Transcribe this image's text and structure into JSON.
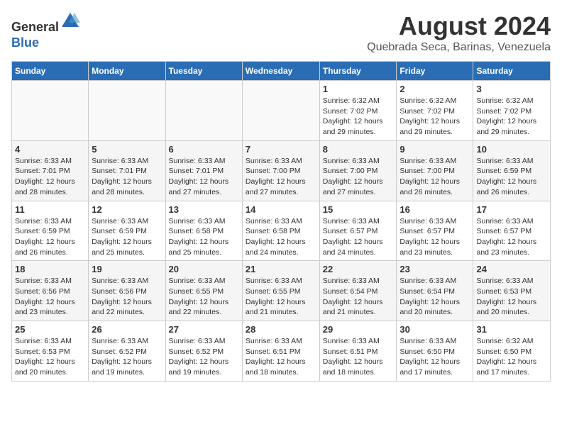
{
  "header": {
    "logo_line1": "General",
    "logo_line2": "Blue",
    "month_title": "August 2024",
    "subtitle": "Quebrada Seca, Barinas, Venezuela"
  },
  "days_of_week": [
    "Sunday",
    "Monday",
    "Tuesday",
    "Wednesday",
    "Thursday",
    "Friday",
    "Saturday"
  ],
  "weeks": [
    [
      {
        "day": "",
        "info": ""
      },
      {
        "day": "",
        "info": ""
      },
      {
        "day": "",
        "info": ""
      },
      {
        "day": "",
        "info": ""
      },
      {
        "day": "1",
        "info": "Sunrise: 6:32 AM\nSunset: 7:02 PM\nDaylight: 12 hours\nand 29 minutes."
      },
      {
        "day": "2",
        "info": "Sunrise: 6:32 AM\nSunset: 7:02 PM\nDaylight: 12 hours\nand 29 minutes."
      },
      {
        "day": "3",
        "info": "Sunrise: 6:32 AM\nSunset: 7:02 PM\nDaylight: 12 hours\nand 29 minutes."
      }
    ],
    [
      {
        "day": "4",
        "info": "Sunrise: 6:33 AM\nSunset: 7:01 PM\nDaylight: 12 hours\nand 28 minutes."
      },
      {
        "day": "5",
        "info": "Sunrise: 6:33 AM\nSunset: 7:01 PM\nDaylight: 12 hours\nand 28 minutes."
      },
      {
        "day": "6",
        "info": "Sunrise: 6:33 AM\nSunset: 7:01 PM\nDaylight: 12 hours\nand 27 minutes."
      },
      {
        "day": "7",
        "info": "Sunrise: 6:33 AM\nSunset: 7:00 PM\nDaylight: 12 hours\nand 27 minutes."
      },
      {
        "day": "8",
        "info": "Sunrise: 6:33 AM\nSunset: 7:00 PM\nDaylight: 12 hours\nand 27 minutes."
      },
      {
        "day": "9",
        "info": "Sunrise: 6:33 AM\nSunset: 7:00 PM\nDaylight: 12 hours\nand 26 minutes."
      },
      {
        "day": "10",
        "info": "Sunrise: 6:33 AM\nSunset: 6:59 PM\nDaylight: 12 hours\nand 26 minutes."
      }
    ],
    [
      {
        "day": "11",
        "info": "Sunrise: 6:33 AM\nSunset: 6:59 PM\nDaylight: 12 hours\nand 26 minutes."
      },
      {
        "day": "12",
        "info": "Sunrise: 6:33 AM\nSunset: 6:59 PM\nDaylight: 12 hours\nand 25 minutes."
      },
      {
        "day": "13",
        "info": "Sunrise: 6:33 AM\nSunset: 6:58 PM\nDaylight: 12 hours\nand 25 minutes."
      },
      {
        "day": "14",
        "info": "Sunrise: 6:33 AM\nSunset: 6:58 PM\nDaylight: 12 hours\nand 24 minutes."
      },
      {
        "day": "15",
        "info": "Sunrise: 6:33 AM\nSunset: 6:57 PM\nDaylight: 12 hours\nand 24 minutes."
      },
      {
        "day": "16",
        "info": "Sunrise: 6:33 AM\nSunset: 6:57 PM\nDaylight: 12 hours\nand 23 minutes."
      },
      {
        "day": "17",
        "info": "Sunrise: 6:33 AM\nSunset: 6:57 PM\nDaylight: 12 hours\nand 23 minutes."
      }
    ],
    [
      {
        "day": "18",
        "info": "Sunrise: 6:33 AM\nSunset: 6:56 PM\nDaylight: 12 hours\nand 23 minutes."
      },
      {
        "day": "19",
        "info": "Sunrise: 6:33 AM\nSunset: 6:56 PM\nDaylight: 12 hours\nand 22 minutes."
      },
      {
        "day": "20",
        "info": "Sunrise: 6:33 AM\nSunset: 6:55 PM\nDaylight: 12 hours\nand 22 minutes."
      },
      {
        "day": "21",
        "info": "Sunrise: 6:33 AM\nSunset: 6:55 PM\nDaylight: 12 hours\nand 21 minutes."
      },
      {
        "day": "22",
        "info": "Sunrise: 6:33 AM\nSunset: 6:54 PM\nDaylight: 12 hours\nand 21 minutes."
      },
      {
        "day": "23",
        "info": "Sunrise: 6:33 AM\nSunset: 6:54 PM\nDaylight: 12 hours\nand 20 minutes."
      },
      {
        "day": "24",
        "info": "Sunrise: 6:33 AM\nSunset: 6:53 PM\nDaylight: 12 hours\nand 20 minutes."
      }
    ],
    [
      {
        "day": "25",
        "info": "Sunrise: 6:33 AM\nSunset: 6:53 PM\nDaylight: 12 hours\nand 20 minutes."
      },
      {
        "day": "26",
        "info": "Sunrise: 6:33 AM\nSunset: 6:52 PM\nDaylight: 12 hours\nand 19 minutes."
      },
      {
        "day": "27",
        "info": "Sunrise: 6:33 AM\nSunset: 6:52 PM\nDaylight: 12 hours\nand 19 minutes."
      },
      {
        "day": "28",
        "info": "Sunrise: 6:33 AM\nSunset: 6:51 PM\nDaylight: 12 hours\nand 18 minutes."
      },
      {
        "day": "29",
        "info": "Sunrise: 6:33 AM\nSunset: 6:51 PM\nDaylight: 12 hours\nand 18 minutes."
      },
      {
        "day": "30",
        "info": "Sunrise: 6:33 AM\nSunset: 6:50 PM\nDaylight: 12 hours\nand 17 minutes."
      },
      {
        "day": "31",
        "info": "Sunrise: 6:32 AM\nSunset: 6:50 PM\nDaylight: 12 hours\nand 17 minutes."
      }
    ]
  ]
}
